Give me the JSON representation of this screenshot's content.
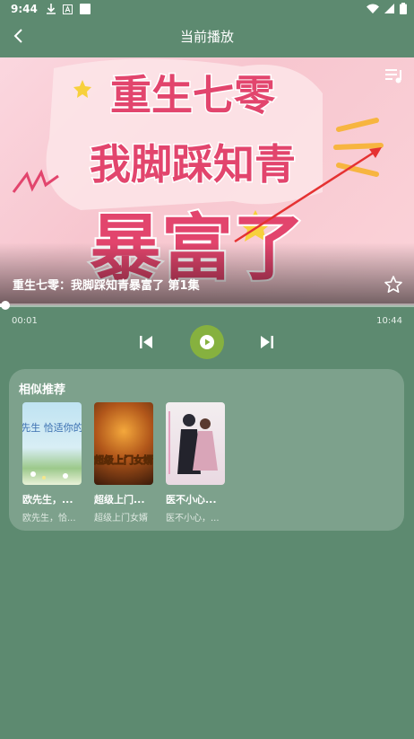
{
  "status": {
    "time": "9:44"
  },
  "header": {
    "title": "当前播放"
  },
  "player": {
    "cover_title_lines": [
      "重生七零",
      "我脚踩知青",
      "暴富了"
    ],
    "episode_title": "重生七零：我脚踩知青暴富了 第1集",
    "current_time": "00:01",
    "total_time": "10:44",
    "progress_fraction": 0.002
  },
  "recommend": {
    "section_title": "相似推荐",
    "items": [
      {
        "name": "欧先生，...",
        "subtitle": "欧先生，恰...",
        "cover_text": "欧先生 恰适你的爱"
      },
      {
        "name": "超级上门...",
        "subtitle": "超级上门女婿",
        "cover_text": "超级上门女婿"
      },
      {
        "name": "医不小心...",
        "subtitle": "医不小心，..."
      }
    ]
  },
  "colors": {
    "background": "#5d8a70",
    "accent": "#86b13f",
    "cover_pink": "#e2456d"
  }
}
